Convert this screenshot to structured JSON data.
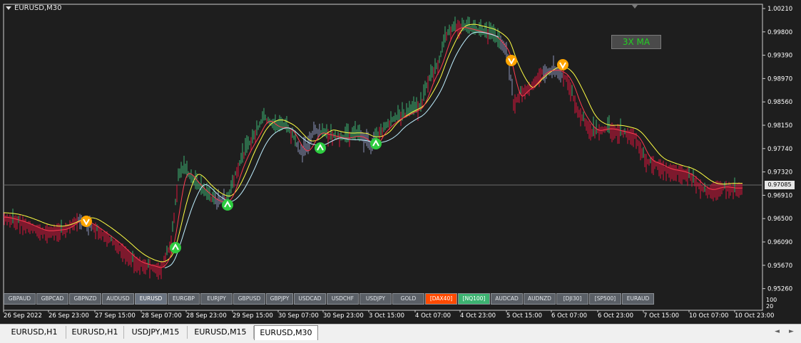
{
  "chart": {
    "symbol_label": "EURUSD,M30",
    "indicator_label": "3X MA",
    "price_labels": [
      "1.00210",
      "0.99800",
      "0.99390",
      "0.98970",
      "0.98560",
      "0.98150",
      "0.97740",
      "0.97320",
      "0.96910",
      "0.96500",
      "0.96090",
      "0.95670",
      "0.95260"
    ],
    "current_price": "0.97085",
    "time_labels": [
      "26 Sep 2022",
      "26 Sep 23:00",
      "27 Sep 15:00",
      "28 Sep 07:00",
      "28 Sep 23:00",
      "29 Sep 15:00",
      "30 Sep 07:00",
      "30 Sep 23:00",
      "3 Oct 15:00",
      "4 Oct 07:00",
      "4 Oct 23:00",
      "5 Oct 15:00",
      "6 Oct 07:00",
      "6 Oct 23:00",
      "7 Oct 15:00",
      "10 Oct 07:00",
      "10 Oct 23:00"
    ],
    "volume_scale": [
      "100",
      "20"
    ],
    "colors": {
      "bull": "#3cb371",
      "bear": "#dc143c",
      "neutral": "#8a92b8",
      "ma_fast": "#ff3a50",
      "ma_mid": "#ffff44",
      "ma_slow": "#bfefff",
      "buy_signal": "#2ecc40",
      "sell_signal": "#ffa500"
    }
  },
  "symbol_buttons": [
    {
      "label": "GBPAUD",
      "state": "normal"
    },
    {
      "label": "GBPCAD",
      "state": "normal"
    },
    {
      "label": "GBPNZD",
      "state": "normal"
    },
    {
      "label": "AUDUSD",
      "state": "normal"
    },
    {
      "label": "EURUSD",
      "state": "active"
    },
    {
      "label": "EURGBP",
      "state": "normal"
    },
    {
      "label": "EURJPY",
      "state": "normal"
    },
    {
      "label": "GBPUSD",
      "state": "normal"
    },
    {
      "label": "GBPJPY",
      "state": "normal"
    },
    {
      "label": "USDCAD",
      "state": "normal"
    },
    {
      "label": "USDCHF",
      "state": "normal"
    },
    {
      "label": "USDJPY",
      "state": "normal"
    },
    {
      "label": "GOLD",
      "state": "normal"
    },
    {
      "label": "[DAX40]",
      "state": "orange"
    },
    {
      "label": "[NQ100]",
      "state": "green"
    },
    {
      "label": "AUDCAD",
      "state": "normal"
    },
    {
      "label": "AUDNZD",
      "state": "normal"
    },
    {
      "label": "[DJI30]",
      "state": "normal"
    },
    {
      "label": "[SP500]",
      "state": "normal"
    },
    {
      "label": "EURAUD",
      "state": "normal"
    }
  ],
  "tabs": [
    {
      "label": "EURUSD,H1",
      "active": false
    },
    {
      "label": "EURUSD,H1",
      "active": false
    },
    {
      "label": "USDJPY,M15",
      "active": false
    },
    {
      "label": "EURUSD,M15",
      "active": false
    },
    {
      "label": "EURUSD,M30",
      "active": true
    }
  ],
  "tab_scroll": {
    "left": "◄",
    "right": "►"
  },
  "chart_data": {
    "type": "line",
    "title": "EURUSD,M30",
    "x": [
      "26 Sep 2022",
      "26 Sep 23:00",
      "27 Sep 15:00",
      "28 Sep 07:00",
      "28 Sep 23:00",
      "29 Sep 15:00",
      "30 Sep 07:00",
      "30 Sep 23:00",
      "3 Oct 15:00",
      "4 Oct 07:00",
      "4 Oct 23:00",
      "5 Oct 15:00",
      "6 Oct 07:00",
      "6 Oct 23:00",
      "7 Oct 15:00",
      "10 Oct 07:00",
      "10 Oct 23:00"
    ],
    "ylim": [
      0.9526,
      1.0021
    ],
    "series": [
      {
        "values": [
          0.969,
          0.966,
          0.964,
          0.9575,
          0.9735,
          0.984,
          0.9795,
          0.979,
          0.9805,
          0.996,
          0.9955,
          0.9895,
          0.992,
          0.981,
          0.975,
          0.9705,
          0.971
        ]
      },
      {
        "values": [
          0.9705,
          0.9673,
          0.965,
          0.962,
          0.974,
          0.982,
          0.98,
          0.979,
          0.981,
          0.989,
          0.9955,
          0.992,
          0.992,
          0.985,
          0.979,
          0.9735,
          0.972
        ]
      }
    ],
    "buy_signals": [
      {
        "x": "28 Sep 07:00",
        "y": 0.96
      },
      {
        "x": "29 Sep 07:00",
        "y": 0.968
      },
      {
        "x": "30 Sep 07:00",
        "y": 0.9777
      },
      {
        "x": "3 Oct 07:00",
        "y": 0.978
      }
    ],
    "sell_signals": [
      {
        "x": "27 Sep 07:00",
        "y": 0.965
      },
      {
        "x": "5 Oct 07:00",
        "y": 0.993
      },
      {
        "x": "6 Oct 07:00",
        "y": 0.992
      }
    ],
    "current_price": 0.97085
  }
}
